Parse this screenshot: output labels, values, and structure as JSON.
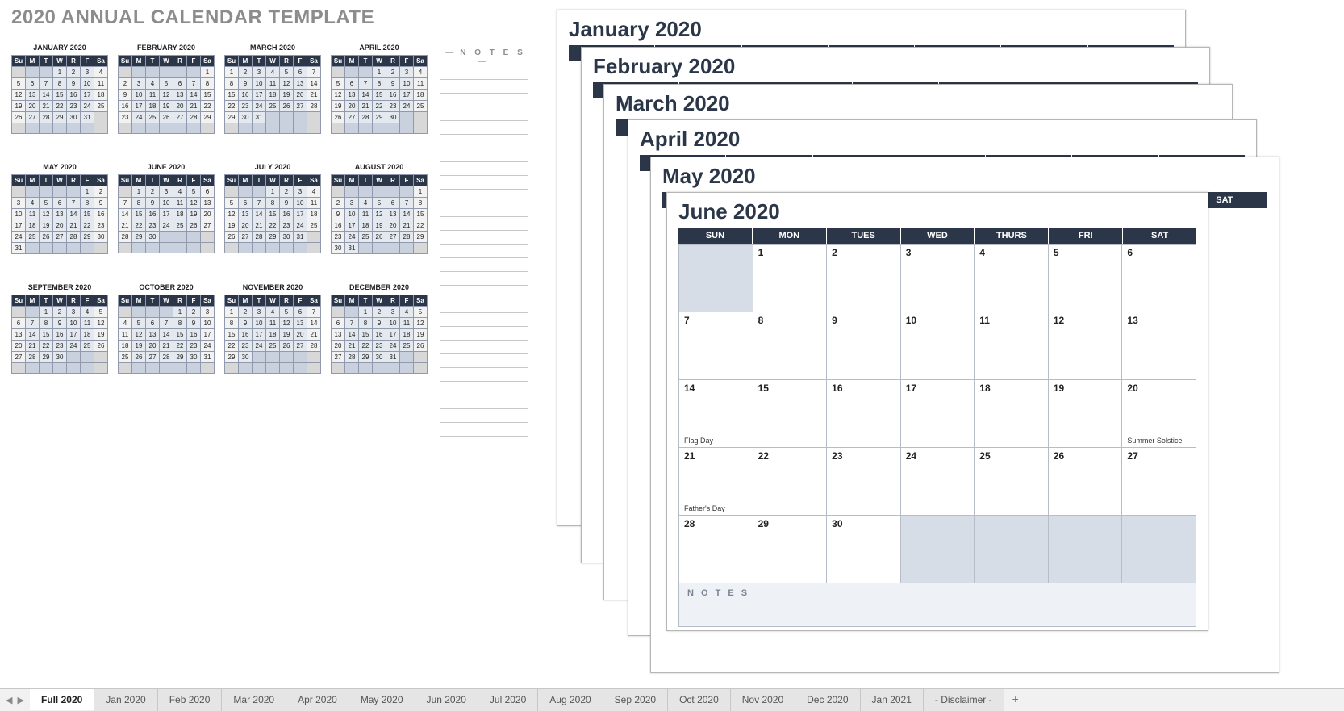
{
  "title": "2020 ANNUAL CALENDAR TEMPLATE",
  "notes_label": "N O T E S",
  "day_short": [
    "Su",
    "M",
    "T",
    "W",
    "R",
    "F",
    "Sa"
  ],
  "day_long": [
    "SUN",
    "MON",
    "TUES",
    "WED",
    "THURS",
    "FRI",
    "SAT"
  ],
  "months": [
    {
      "name": "JANUARY 2020",
      "start": 3,
      "days": 31
    },
    {
      "name": "FEBRUARY 2020",
      "start": 6,
      "days": 29
    },
    {
      "name": "MARCH 2020",
      "start": 0,
      "days": 31
    },
    {
      "name": "APRIL 2020",
      "start": 3,
      "days": 30
    },
    {
      "name": "MAY 2020",
      "start": 5,
      "days": 31
    },
    {
      "name": "JUNE 2020",
      "start": 1,
      "days": 30
    },
    {
      "name": "JULY 2020",
      "start": 3,
      "days": 31
    },
    {
      "name": "AUGUST 2020",
      "start": 6,
      "days": 31
    },
    {
      "name": "SEPTEMBER 2020",
      "start": 2,
      "days": 30
    },
    {
      "name": "OCTOBER 2020",
      "start": 4,
      "days": 31
    },
    {
      "name": "NOVEMBER 2020",
      "start": 0,
      "days": 30
    },
    {
      "name": "DECEMBER 2020",
      "start": 2,
      "days": 31
    }
  ],
  "stack_sheets": [
    {
      "title": "January 2020"
    },
    {
      "title": "February 2020"
    },
    {
      "title": "March 2020"
    },
    {
      "title": "April 2020"
    },
    {
      "title": "May 2020"
    }
  ],
  "front_sheet": {
    "title": "June 2020",
    "start": 1,
    "days": 30,
    "holidays": {
      "14": "Flag Day",
      "20": "Summer Solstice",
      "21": "Father's Day"
    },
    "notes_label": "N O T E S"
  },
  "tabs": [
    "Full 2020",
    "Jan 2020",
    "Feb 2020",
    "Mar 2020",
    "Apr 2020",
    "May 2020",
    "Jun 2020",
    "Jul 2020",
    "Aug 2020",
    "Sep 2020",
    "Oct 2020",
    "Nov 2020",
    "Dec 2020",
    "Jan 2021",
    "- Disclaimer -"
  ],
  "active_tab": 0
}
